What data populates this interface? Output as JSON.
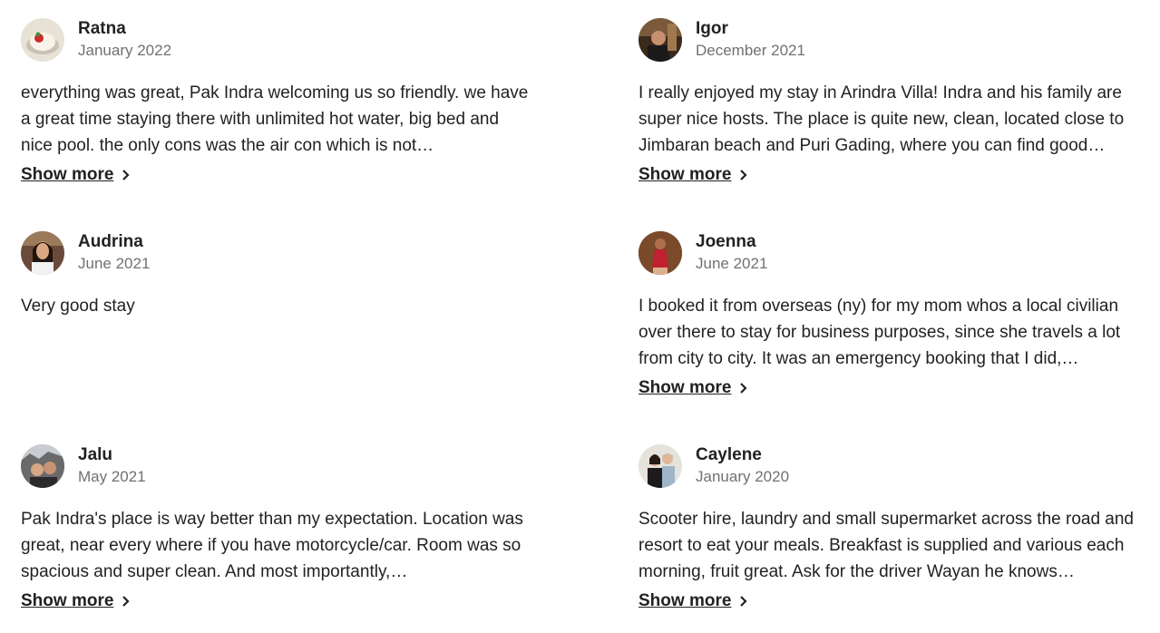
{
  "reviews": [
    {
      "name": "Ratna",
      "date": "January 2022",
      "text": "everything was great, Pak Indra welcoming us so friendly. we have a great time staying there with unlimited hot water, big bed and nice pool. the only cons was the air con which is not…",
      "show_more": "Show more",
      "avatar_icon": "dessert-photo-avatar"
    },
    {
      "name": "Igor",
      "date": "December 2021",
      "text": "I really enjoyed my stay in Arindra Villa! Indra and his family are super nice hosts. The place is quite new, clean, located close to Jimbaran beach and Puri Gading, where you can find good…",
      "show_more": "Show more",
      "avatar_icon": "person-photo-avatar"
    },
    {
      "name": "Audrina",
      "date": "June 2021",
      "text": "Very good stay",
      "show_more": "",
      "avatar_icon": "person-photo-avatar"
    },
    {
      "name": "Joenna",
      "date": "June 2021",
      "text": "I booked it from overseas (ny) for my mom whos a local civilian over there to stay for business purposes, since she travels a lot from city to city. It was an emergency booking that I did,…",
      "show_more": "Show more",
      "avatar_icon": "person-photo-avatar"
    },
    {
      "name": "Jalu",
      "date": "May 2021",
      "text": "Pak Indra's place is way better than my expectation. Location was great, near every where if you have motorcycle/car. Room was so spacious and super clean. And most importantly,…",
      "show_more": "Show more",
      "avatar_icon": "couple-photo-avatar"
    },
    {
      "name": "Caylene",
      "date": "January 2020",
      "text": "Scooter hire, laundry and small supermarket across the road and resort to eat your meals. Breakfast is supplied and various each morning, fruit great. Ask for the driver Wayan he knows…",
      "show_more": "Show more",
      "avatar_icon": "couple-photo-avatar"
    }
  ]
}
